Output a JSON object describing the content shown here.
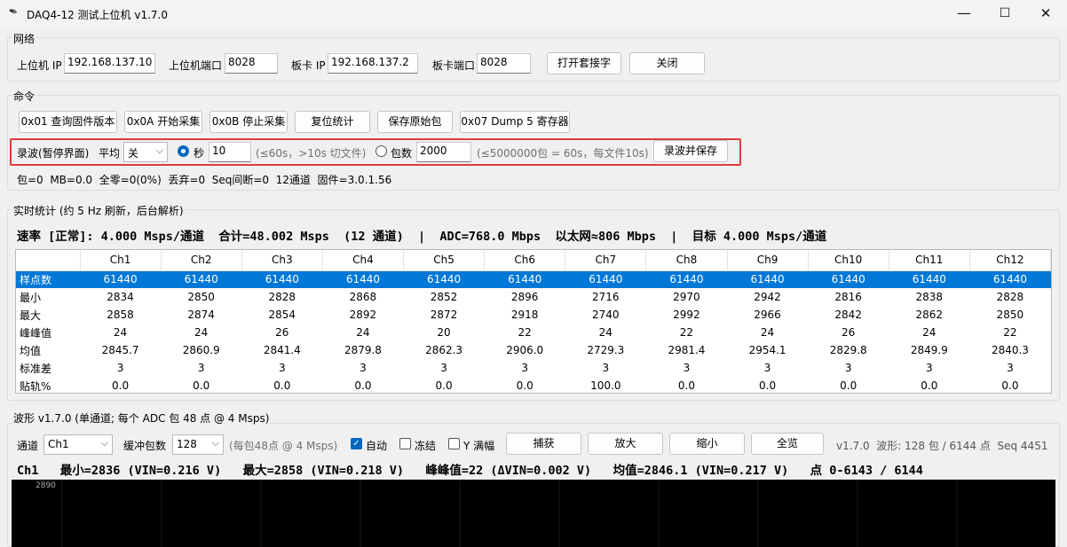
{
  "window": {
    "title": "DAQ4-12 测试上位机 v1.7.0",
    "minimize": "—",
    "maximize": "☐",
    "close": "✕"
  },
  "network": {
    "group_label": "网络",
    "host_ip_label": "上位机 IP",
    "host_ip": "192.168.137.10",
    "host_port_label": "上位机端口",
    "host_port": "8028",
    "board_ip_label": "板卡 IP",
    "board_ip": "192.168.137.2",
    "board_port_label": "板卡端口",
    "board_port": "8028",
    "open_socket": "打开套接字",
    "close": "关闭"
  },
  "commands": {
    "group_label": "命令",
    "buttons": [
      "0x01 查询固件版本",
      "0x0A 开始采集",
      "0x0B 停止采集",
      "复位统计",
      "保存原始包",
      "0x07 Dump 5 寄存器"
    ],
    "record_label": "录波(暂停界面)",
    "avg_label": "平均",
    "avg_value": "关",
    "seconds_label": "秒",
    "seconds_value": "10",
    "seconds_hint": "(≤60s，>10s 切文件)",
    "packets_label": "包数",
    "packets_value": "2000",
    "packets_hint": "(≤5000000包 = 60s，每文件10s)",
    "record_save": "录波并保存",
    "status": "包=0  MB=0.0  全零=0(0%)  丢弃=0  Seq间断=0  12通道  固件=3.0.1.56"
  },
  "stats": {
    "group_label": "实时统计 (约 5 Hz 刷新，后台解析)",
    "rate_line": "速率 [正常]: 4.000 Msps/通道  合计=48.002 Msps  (12 通道)  |  ADC=768.0 Mbps  以太网≈806 Mbps  |  目标 4.000 Msps/通道",
    "columns": [
      "",
      "Ch1",
      "Ch2",
      "Ch3",
      "Ch4",
      "Ch5",
      "Ch6",
      "Ch7",
      "Ch8",
      "Ch9",
      "Ch10",
      "Ch11",
      "Ch12"
    ],
    "rows": [
      [
        "样点数",
        "61440",
        "61440",
        "61440",
        "61440",
        "61440",
        "61440",
        "61440",
        "61440",
        "61440",
        "61440",
        "61440",
        "61440"
      ],
      [
        "最小",
        "2834",
        "2850",
        "2828",
        "2868",
        "2852",
        "2896",
        "2716",
        "2970",
        "2942",
        "2816",
        "2838",
        "2828"
      ],
      [
        "最大",
        "2858",
        "2874",
        "2854",
        "2892",
        "2872",
        "2918",
        "2740",
        "2992",
        "2966",
        "2842",
        "2862",
        "2850"
      ],
      [
        "峰峰值",
        "24",
        "24",
        "26",
        "24",
        "20",
        "22",
        "24",
        "22",
        "24",
        "26",
        "24",
        "22"
      ],
      [
        "均值",
        "2845.7",
        "2860.9",
        "2841.4",
        "2879.8",
        "2862.3",
        "2906.0",
        "2729.3",
        "2981.4",
        "2954.1",
        "2829.8",
        "2849.9",
        "2840.3"
      ],
      [
        "标准差",
        "3",
        "3",
        "3",
        "3",
        "3",
        "3",
        "3",
        "3",
        "3",
        "3",
        "3",
        "3"
      ],
      [
        "贴轨%",
        "0.0",
        "0.0",
        "0.0",
        "0.0",
        "0.0",
        "0.0",
        "100.0",
        "0.0",
        "0.0",
        "0.0",
        "0.0",
        "0.0"
      ]
    ]
  },
  "waveform": {
    "group_label": "波形 v1.7.0 (单通道; 每个 ADC 包 48 点 @ 4 Msps)",
    "channel_label": "通道",
    "channel_value": "Ch1",
    "buffer_label": "缓冲包数",
    "buffer_value": "128",
    "buffer_hint": "(每包48点 @ 4 Msps)",
    "auto_label": "自动",
    "freeze_label": "冻结",
    "yfull_label": "Y 满幅",
    "capture": "捕获",
    "zoom_in": "放大",
    "zoom_out": "缩小",
    "overview": "全览",
    "info": "v1.7.0  波形: 128 包 / 6144 点  Seq 4451",
    "readout": "Ch1   最小=2836 (VIN=0.216 V)   最大=2858 (VIN=0.218 V)   峰峰值=22 (ΔVIN=0.002 V)   均值=2846.1 (VIN=0.217 V)   点 0-6143 / 6144",
    "y_tick": "2890"
  }
}
